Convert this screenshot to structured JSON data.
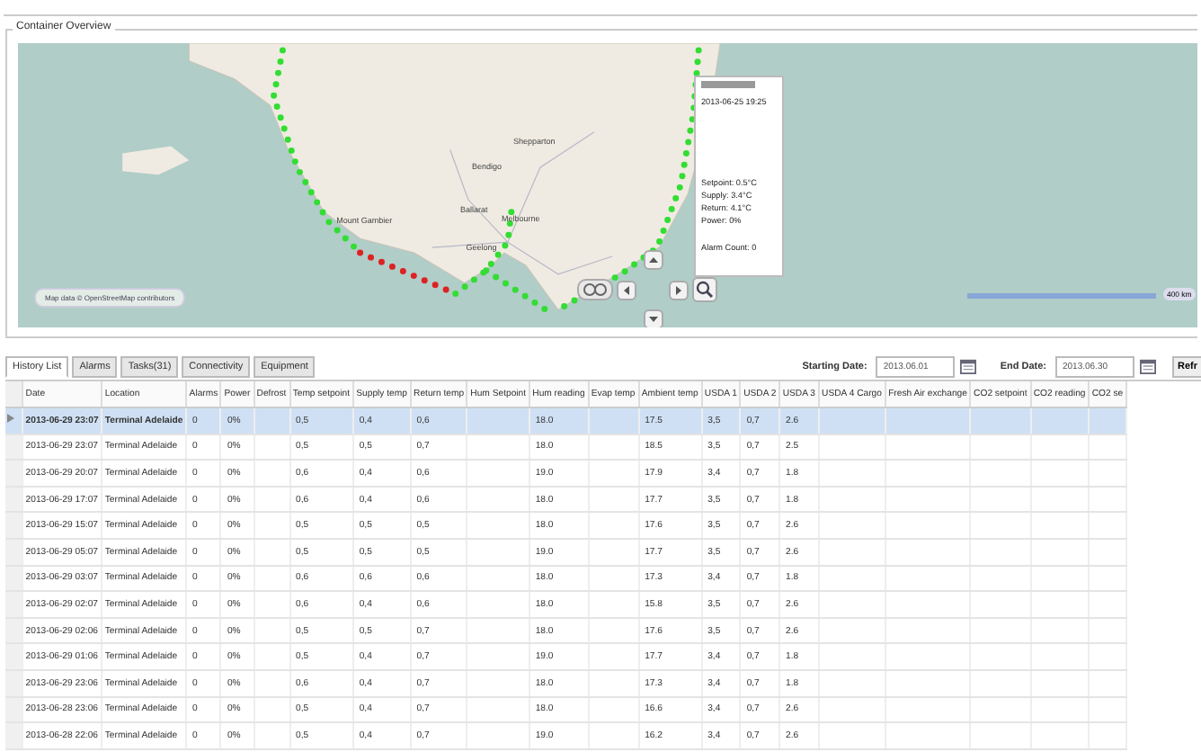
{
  "panel": {
    "title": "Container Overview"
  },
  "map": {
    "labels": [
      "Shepparton",
      "Bendigo",
      "Ballarat",
      "Melbourne",
      "Geelong",
      "Mount Gambier"
    ],
    "route_segments": [
      {
        "color": "#33dd33"
      },
      {
        "color": "#dd2222"
      },
      {
        "color": "#33dd33"
      },
      {
        "color": "#33dd33"
      }
    ],
    "popup": {
      "timestamp": "2013-06-25 19:25",
      "lines": [
        "Setpoint: 0.5°C",
        "Supply: 3.4°C",
        "Return: 4.1°C",
        "Power: 0%"
      ],
      "alarm_count": "Alarm Count: 0"
    },
    "attribution": "Map data © OpenStreetMap contributors",
    "scale": "400 km"
  },
  "tabs": [
    {
      "label": "History List",
      "selected": true
    },
    {
      "label": "Alarms",
      "selected": false
    },
    {
      "label": "Tasks(31)",
      "selected": false
    },
    {
      "label": "Connectivity",
      "selected": false
    },
    {
      "label": "Equipment",
      "selected": false
    }
  ],
  "date_filter": {
    "start_label": "Starting Date:",
    "start_value": "2013.06.01",
    "end_label": "End Date:",
    "end_value": "2013.06.30",
    "button": "Refr"
  },
  "table": {
    "columns": [
      "Date",
      "Location",
      "Alarms",
      "Power",
      "Defrost",
      "Temp setpoint",
      "Supply temp",
      "Return temp",
      "Hum Setpoint",
      "Hum reading",
      "Evap temp",
      "Ambient temp",
      "USDA 1",
      "USDA 2",
      "USDA 3",
      "USDA 4 Cargo",
      "Fresh Air exchange",
      "CO2 setpoint",
      "CO2 reading",
      "CO2 se"
    ],
    "rows": [
      {
        "selected": true,
        "cells": [
          "2013-06-29 23:07",
          "Terminal Adelaide",
          "0",
          "0%",
          "",
          "0,5",
          "0,4",
          "0,6",
          "",
          "18.0",
          "",
          "17.5",
          "3,5",
          "0,7",
          "2.6",
          "",
          "",
          "",
          "",
          ""
        ]
      },
      {
        "selected": false,
        "cells": [
          "2013-06-29 23:07",
          "Terminal Adelaide",
          "0",
          "0%",
          "",
          "0,5",
          "0,5",
          "0,7",
          "",
          "18.0",
          "",
          "18.5",
          "3,5",
          "0,7",
          "2.5",
          "",
          "",
          "",
          "",
          ""
        ]
      },
      {
        "selected": false,
        "cells": [
          "2013-06-29 20:07",
          "Terminal Adelaide",
          "0",
          "0%",
          "",
          "0,6",
          "0,4",
          "0,6",
          "",
          "19.0",
          "",
          "17.9",
          "3,4",
          "0,7",
          "1.8",
          "",
          "",
          "",
          "",
          ""
        ]
      },
      {
        "selected": false,
        "cells": [
          "2013-06-29 17:07",
          "Terminal Adelaide",
          "0",
          "0%",
          "",
          "0,6",
          "0,4",
          "0,6",
          "",
          "18.0",
          "",
          "17.7",
          "3,5",
          "0,7",
          "1.8",
          "",
          "",
          "",
          "",
          ""
        ]
      },
      {
        "selected": false,
        "cells": [
          "2013-06-29 15:07",
          "Terminal Adelaide",
          "0",
          "0%",
          "",
          "0,5",
          "0,5",
          "0,5",
          "",
          "18.0",
          "",
          "17.6",
          "3,5",
          "0,7",
          "2.6",
          "",
          "",
          "",
          "",
          ""
        ]
      },
      {
        "selected": false,
        "cells": [
          "2013-06-29 05:07",
          "Terminal Adelaide",
          "0",
          "0%",
          "",
          "0,5",
          "0,5",
          "0,5",
          "",
          "19.0",
          "",
          "17.7",
          "3,5",
          "0,7",
          "2.6",
          "",
          "",
          "",
          "",
          ""
        ]
      },
      {
        "selected": false,
        "cells": [
          "2013-06-29 03:07",
          "Terminal Adelaide",
          "0",
          "0%",
          "",
          "0,6",
          "0,6",
          "0,6",
          "",
          "18.0",
          "",
          "17.3",
          "3,4",
          "0,7",
          "1.8",
          "",
          "",
          "",
          "",
          ""
        ]
      },
      {
        "selected": false,
        "cells": [
          "2013-06-29 02:07",
          "Terminal Adelaide",
          "0",
          "0%",
          "",
          "0,6",
          "0,4",
          "0,6",
          "",
          "18.0",
          "",
          "15.8",
          "3,5",
          "0,7",
          "2.6",
          "",
          "",
          "",
          "",
          ""
        ]
      },
      {
        "selected": false,
        "cells": [
          "2013-06-29 02:06",
          "Terminal Adelaide",
          "0",
          "0%",
          "",
          "0,5",
          "0,5",
          "0,7",
          "",
          "18.0",
          "",
          "17.6",
          "3,5",
          "0,7",
          "2.6",
          "",
          "",
          "",
          "",
          ""
        ]
      },
      {
        "selected": false,
        "cells": [
          "2013-06-29 01:06",
          "Terminal Adelaide",
          "0",
          "0%",
          "",
          "0,5",
          "0,4",
          "0,7",
          "",
          "19.0",
          "",
          "17.7",
          "3,4",
          "0,7",
          "1.8",
          "",
          "",
          "",
          "",
          ""
        ]
      },
      {
        "selected": false,
        "cells": [
          "2013-06-29 23:06",
          "Terminal Adelaide",
          "0",
          "0%",
          "",
          "0,6",
          "0,4",
          "0,7",
          "",
          "18.0",
          "",
          "17.3",
          "3,4",
          "0,7",
          "1.8",
          "",
          "",
          "",
          "",
          ""
        ]
      },
      {
        "selected": false,
        "cells": [
          "2013-06-28 23:06",
          "Terminal Adelaide",
          "0",
          "0%",
          "",
          "0,5",
          "0,4",
          "0,7",
          "",
          "18.0",
          "",
          "16.6",
          "3,4",
          "0,7",
          "2.6",
          "",
          "",
          "",
          "",
          ""
        ]
      },
      {
        "selected": false,
        "cells": [
          "2013-06-28 22:06",
          "Terminal Adelaide",
          "0",
          "0%",
          "",
          "0,5",
          "0,4",
          "0,7",
          "",
          "19.0",
          "",
          "16.2",
          "3,4",
          "0,7",
          "2.6",
          "",
          "",
          "",
          "",
          ""
        ]
      }
    ]
  }
}
